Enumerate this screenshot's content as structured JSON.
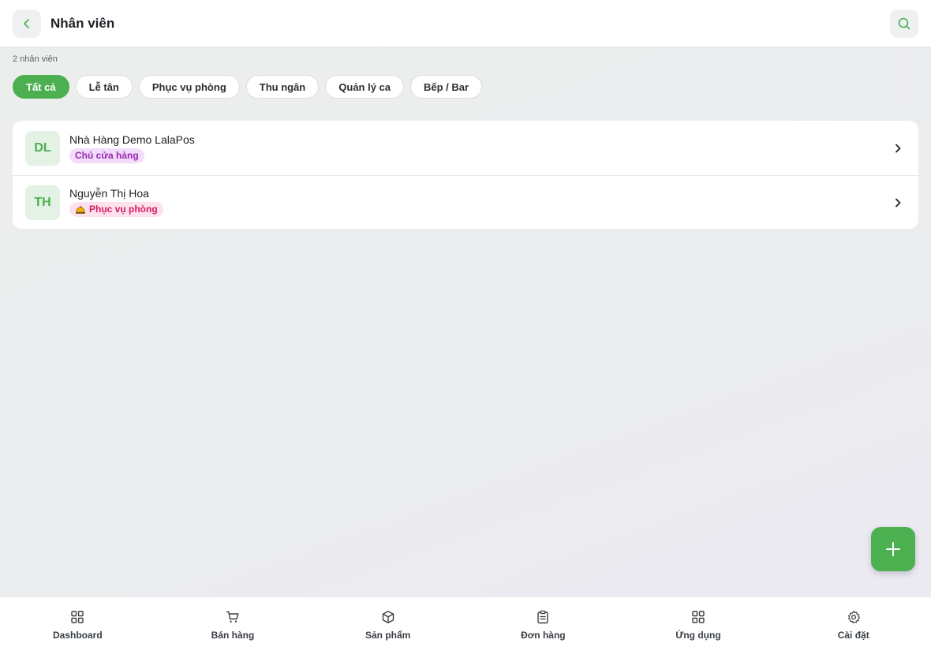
{
  "header": {
    "title": "Nhân viên"
  },
  "summary": {
    "count_text": "2 nhân viên"
  },
  "filters": [
    {
      "label": "Tất cả",
      "active": true
    },
    {
      "label": "Lễ tân",
      "active": false
    },
    {
      "label": "Phục vụ phòng",
      "active": false
    },
    {
      "label": "Thu ngân",
      "active": false
    },
    {
      "label": "Quản lý ca",
      "active": false
    },
    {
      "label": "Bếp / Bar",
      "active": false
    }
  ],
  "employees": [
    {
      "initials": "DL",
      "name": "Nhà Hàng Demo LalaPos",
      "role": "Chủ cửa hàng",
      "role_icon": ""
    },
    {
      "initials": "TH",
      "name": "Nguyễn Thị Hoa",
      "role": "Phục vụ phòng",
      "role_icon": "bell-icon"
    }
  ],
  "nav": [
    {
      "label": "Dashboard",
      "icon": "dashboard-icon"
    },
    {
      "label": "Bán hàng",
      "icon": "cart-icon"
    },
    {
      "label": "Sản phẩm",
      "icon": "box-icon"
    },
    {
      "label": "Đơn hàng",
      "icon": "clipboard-icon"
    },
    {
      "label": "Ứng dụng",
      "icon": "apps-icon"
    },
    {
      "label": "Cài đặt",
      "icon": "gear-icon"
    }
  ],
  "colors": {
    "accent": "#4caf50",
    "owner_badge": "#9b27b0",
    "service_badge": "#d81b60"
  }
}
